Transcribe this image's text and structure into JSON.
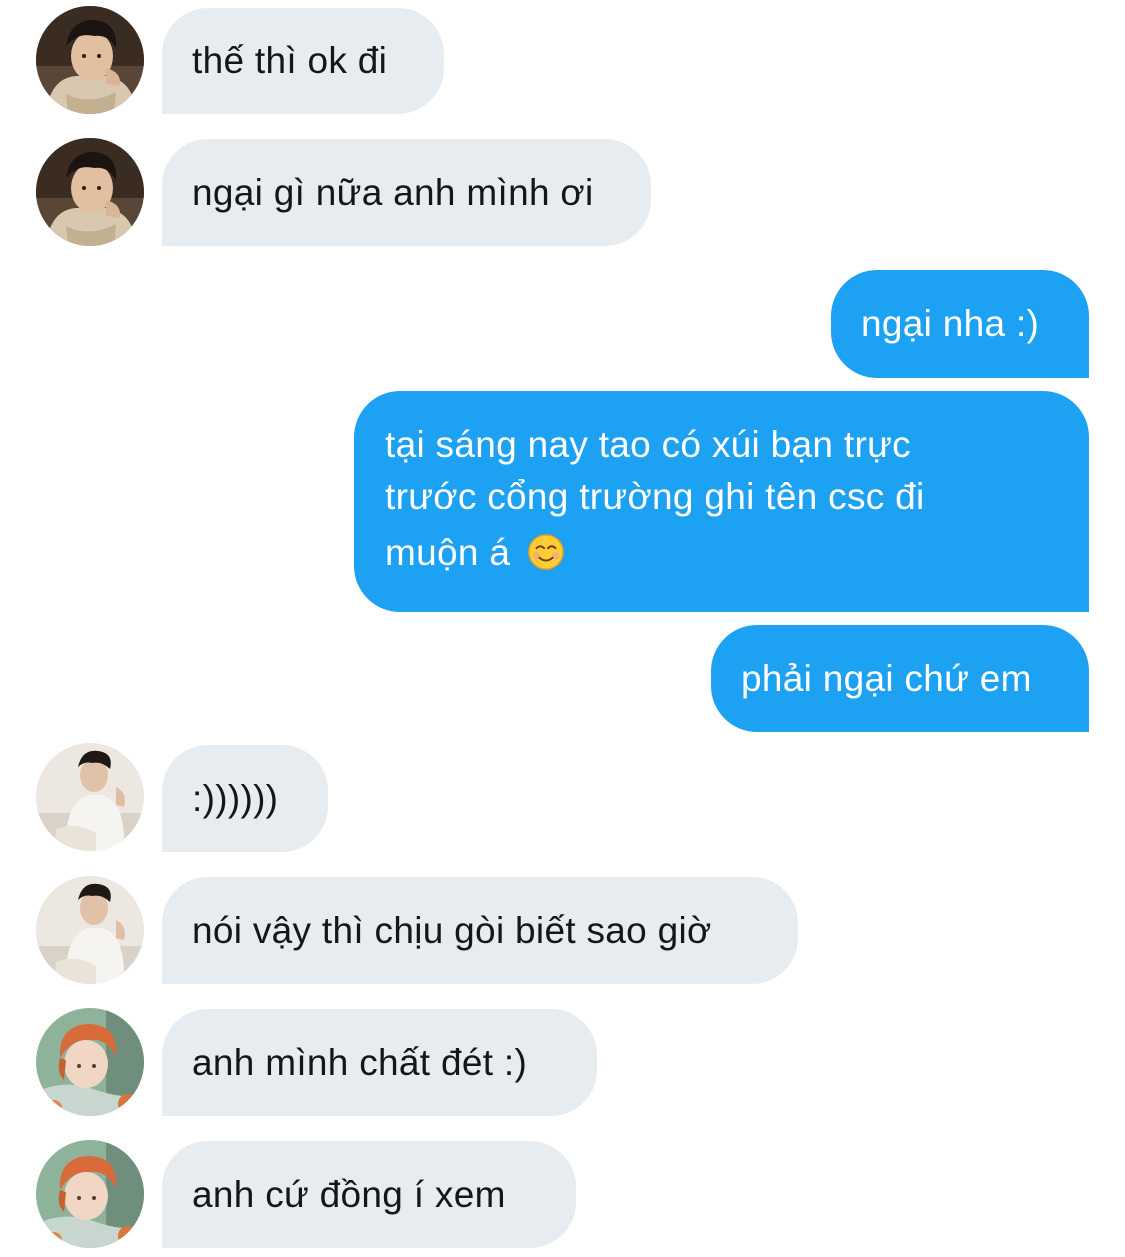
{
  "conversation": {
    "messages": [
      {
        "side": "in",
        "avatar": "avatar-1",
        "text": "thế thì ok đi"
      },
      {
        "side": "in",
        "avatar": "avatar-1",
        "text": "ngại gì nữa anh mình ơi"
      },
      {
        "side": "out",
        "text": "ngại nha :)"
      },
      {
        "side": "out",
        "line1": "tại sáng nay tao có xúi bạn trực",
        "line2": "trước cổng trường ghi tên csc đi",
        "line3": "muộn á",
        "emoji": "smiling-face-emoji"
      },
      {
        "side": "out",
        "text": "phải ngại chứ em"
      },
      {
        "side": "in",
        "avatar": "avatar-2",
        "text": ":))))))"
      },
      {
        "side": "in",
        "avatar": "avatar-2",
        "text": "nói vậy thì chịu gòi biết sao giờ"
      },
      {
        "side": "in",
        "avatar": "avatar-3",
        "text": "anh mình chất đét :)"
      },
      {
        "side": "in",
        "avatar": "avatar-3",
        "text": "anh cứ đồng í xem"
      }
    ]
  },
  "colors": {
    "incoming_bubble": "#e6ecf0",
    "outgoing_bubble": "#1da1f2",
    "incoming_text": "#14171a",
    "outgoing_text": "#ffffff"
  }
}
